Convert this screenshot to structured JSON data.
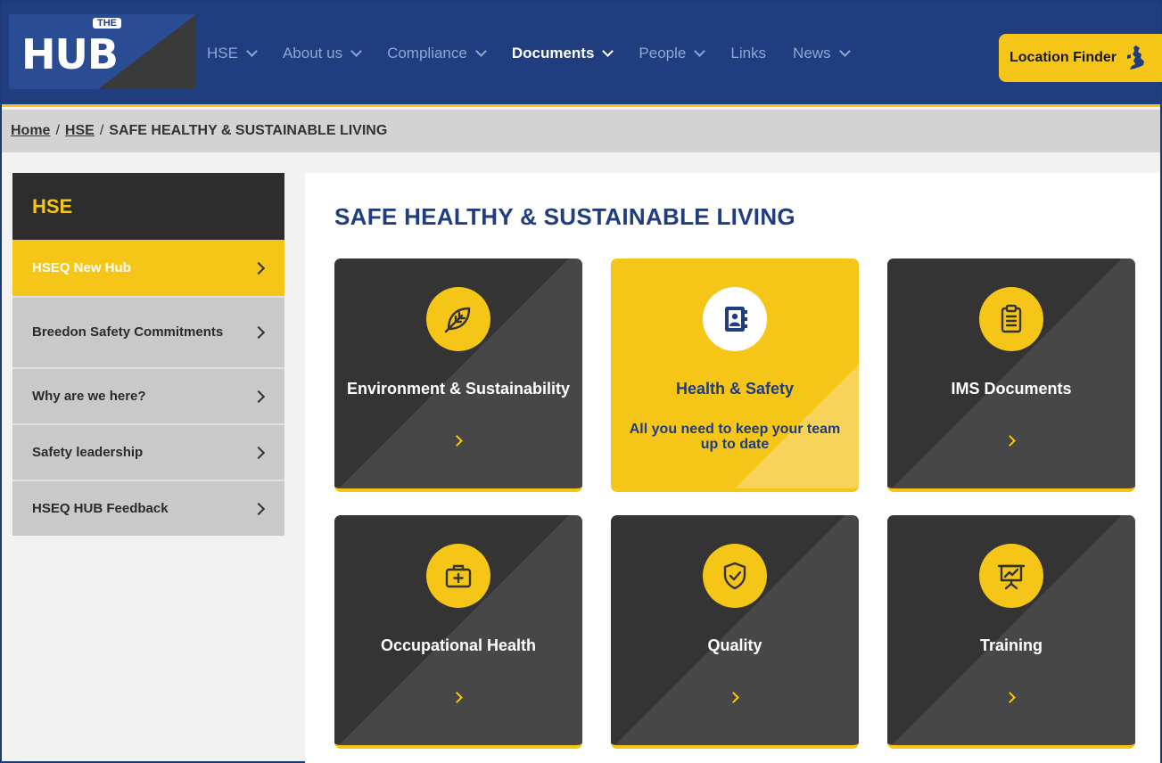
{
  "brand": {
    "logo_word": "HUB",
    "logo_tag": "THE",
    "accent": "#f5c518",
    "navy": "#1f3d7f"
  },
  "nav": {
    "items": [
      {
        "label": "HSE",
        "has_dropdown": true
      },
      {
        "label": "About us",
        "has_dropdown": true
      },
      {
        "label": "Compliance",
        "has_dropdown": true
      },
      {
        "label": "Documents",
        "has_dropdown": true,
        "active": true
      },
      {
        "label": "People",
        "has_dropdown": true
      },
      {
        "label": "Links",
        "has_dropdown": false
      },
      {
        "label": "News",
        "has_dropdown": true
      }
    ],
    "location_finder": "Location Finder",
    "location_icon": "uk-map-icon"
  },
  "breadcrumb": {
    "home": "Home",
    "sep": "/",
    "section": "HSE",
    "current": "SAFE HEALTHY & SUSTAINABLE LIVING"
  },
  "sidebar": {
    "heading": "HSE",
    "items": [
      {
        "label": "HSEQ New Hub",
        "active": true
      },
      {
        "label": "Breedon Safety Commitments"
      },
      {
        "label": "Why are we here?"
      },
      {
        "label": "Safety leadership"
      },
      {
        "label": "HSEQ HUB Feedback"
      }
    ]
  },
  "main": {
    "title": "SAFE HEALTHY & SUSTAINABLE LIVING",
    "cards": [
      {
        "title": "Environment & Sustainability",
        "icon": "leaf-icon",
        "style": "dark"
      },
      {
        "title": "Health & Safety",
        "description": "All you need to keep your team up to date",
        "icon": "contact-book-icon",
        "style": "yellow"
      },
      {
        "title": "IMS Documents",
        "icon": "clipboard-icon",
        "style": "dark"
      },
      {
        "title": "Occupational Health",
        "icon": "medical-bag-icon",
        "style": "dark"
      },
      {
        "title": "Quality",
        "icon": "shield-check-icon",
        "style": "dark"
      },
      {
        "title": "Training",
        "icon": "presentation-board-icon",
        "style": "dark"
      }
    ]
  }
}
